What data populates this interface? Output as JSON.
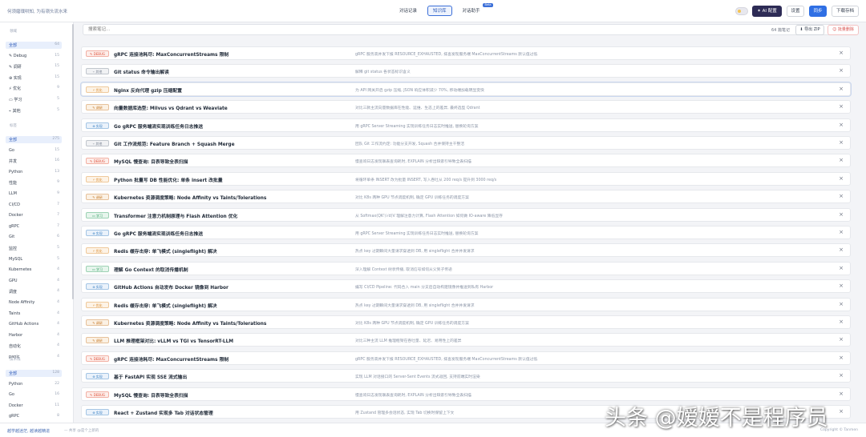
{
  "header": {
    "slogan": "何须磨璞哄知, 为有嶺头流水来",
    "tabs": [
      {
        "label": "对话记录",
        "active": false
      },
      {
        "label": "知识库",
        "active": true
      },
      {
        "label": "对话助手",
        "active": false,
        "badge": "Beta"
      }
    ],
    "ai_button": "✦ AI 配置",
    "settings_button": "设置",
    "sync_button": "同步",
    "download_button": "下载存档"
  },
  "sidebar": {
    "sections": [
      {
        "title": "领域",
        "items": [
          {
            "label": "全部",
            "count": "64",
            "selected": true
          },
          {
            "label": "✎ Debug",
            "count": "15"
          },
          {
            "label": "✎ 调研",
            "count": "15"
          },
          {
            "label": "⊕ 实现",
            "count": "15"
          },
          {
            "label": "⚡ 优化",
            "count": "9"
          },
          {
            "label": "▭ 学习",
            "count": "5"
          },
          {
            "label": "⌁ 其他",
            "count": "5"
          }
        ]
      },
      {
        "title": "标签",
        "items": [
          {
            "label": "全部",
            "count": "275",
            "selected": true
          },
          {
            "label": "Go",
            "count": "15"
          },
          {
            "label": "并发",
            "count": "16"
          },
          {
            "label": "Python",
            "count": "13"
          },
          {
            "label": "性能",
            "count": "9"
          },
          {
            "label": "LLM",
            "count": "9"
          },
          {
            "label": "CI/CD",
            "count": "7"
          },
          {
            "label": "Docker",
            "count": "7"
          },
          {
            "label": "gRPC",
            "count": "7"
          },
          {
            "label": "Git",
            "count": "6"
          },
          {
            "label": "监控",
            "count": "5"
          },
          {
            "label": "MySQL",
            "count": "5"
          },
          {
            "label": "Kubernetes",
            "count": "4"
          },
          {
            "label": "GPU",
            "count": "4"
          },
          {
            "label": "调度",
            "count": "4"
          },
          {
            "label": "Node Affinity",
            "count": "4"
          },
          {
            "label": "Taints",
            "count": "4"
          },
          {
            "label": "GitHub Actions",
            "count": "4"
          },
          {
            "label": "Harbor",
            "count": "4"
          },
          {
            "label": "自动化",
            "count": "4"
          },
          {
            "label": "panic",
            "count": "4"
          }
        ]
      },
      {
        "title": "技术栈",
        "items": [
          {
            "label": "全部",
            "count": "128",
            "selected": true
          },
          {
            "label": "Python",
            "count": "22"
          },
          {
            "label": "Go",
            "count": "16"
          },
          {
            "label": "Docker",
            "count": "11"
          },
          {
            "label": "gRPC",
            "count": "8"
          }
        ]
      }
    ]
  },
  "toolbar": {
    "search_placeholder": "搜索笔记...",
    "note_count": "64 篇笔记",
    "export_label": "⬇ 导出 ZIP",
    "bulk_delete_label": "☺ 批量删除"
  },
  "tag_styles": {
    "DEBUG": {
      "color": "#e0533d",
      "bg": "#fdeeea"
    },
    "实现": {
      "color": "#3b82c4",
      "bg": "#eaf2fb"
    },
    "优化": {
      "color": "#d9892b",
      "bg": "#fdf3e6"
    },
    "调研": {
      "color": "#c77b2a",
      "bg": "#fbf1e4"
    },
    "学习": {
      "color": "#2f9e62",
      "bg": "#e6f5ec"
    },
    "其他": {
      "color": "#7b8494",
      "bg": "#f1f2f4"
    }
  },
  "rows": [
    {
      "tag": "DEBUG",
      "tag_label": "✎ DEBUG",
      "title": "gRPC 连接池耗尽: MaxConcurrentStreams 限制",
      "desc": "gRPC 服务高并发下报 RESOURCE_EXHAUSTED, 排查发现服务端 MaxConcurrentStreams 默认值过低"
    },
    {
      "tag": "其他",
      "tag_label": "⌁ 其他",
      "title": "Git status 命令输出解读",
      "desc": "解释 git status 各状态标识含义"
    },
    {
      "tag": "优化",
      "tag_label": "⚡ 优化",
      "title": "Nginx 反向代理 gzip 压缩配置",
      "desc": "为 API 网关开启 gzip 压缩, JSON 响应体积减少 70%, 移动端加载明显变快",
      "highlight": true
    },
    {
      "tag": "调研",
      "tag_label": "✎ 调研",
      "title": "向量数据库选型: Milvus vs Qdrant vs Weaviate",
      "desc": "对比三款主流向量数据库在性能、运维、生态上的差异, 最终选型 Qdrant"
    },
    {
      "tag": "实现",
      "tag_label": "⊕ 实现",
      "title": "Go gRPC 服务端流实现训练任务日志推送",
      "desc": "用 gRPC Server Streaming 实现训练任务日志实时推送, 替换轮询方案"
    },
    {
      "tag": "其他",
      "tag_label": "⌁ 其他",
      "title": "Git 工作流规范: Feature Branch + Squash Merge",
      "desc": "团队 Git 工作流约定: 功能分支开发, Squash 合并保持主干整洁"
    },
    {
      "tag": "DEBUG",
      "tag_label": "✎ DEBUG",
      "title": "MySQL 慢查询: 目表导致全表扫描",
      "desc": "慢查询日志发现联表查询耗时, EXPLAIN 分析出缺索引导致全表扫描"
    },
    {
      "tag": "优化",
      "tag_label": "⚡ 优化",
      "title": "Python 批量写 DB 性能优化: 单条 insert 改批量",
      "desc": "将循环单条 INSERT 改为批量 INSERT, 写入吞吐从 200 req/s 提升到 3000 req/s"
    },
    {
      "tag": "调研",
      "tag_label": "✎ 调研",
      "title": "Kubernetes 资源调度策略: Node Affinity vs Taints/Tolerations",
      "desc": "对比 K8s 两种 GPU 节点调度机制, 确定 GPU 训练任务的调度方案"
    },
    {
      "tag": "学习",
      "tag_label": "▭ 学习",
      "title": "Transformer 注意力机制原理与 Flash Attention 优化",
      "desc": "从 Softmax(QKᵀ/√d)V 理解注意力计算, Flash Attention 如何做 IO-aware 降低显存"
    },
    {
      "tag": "实现",
      "tag_label": "⊕ 实现",
      "title": "Go gRPC 服务端流实现训练任务日志推送",
      "desc": "用 gRPC Server Streaming 实现训练任务日志实时推送, 替换轮询方案"
    },
    {
      "tag": "优化",
      "tag_label": "⚡ 优化",
      "title": "Redis 缓存击穿: 单飞模式 (singleflight) 解决",
      "desc": "热点 key 过期瞬间大量请求穿透到 DB, 用 singleflight 合并并发请求"
    },
    {
      "tag": "学习",
      "tag_label": "▭ 学习",
      "title": "理解 Go Context 的取消传播机制",
      "desc": "深入理解 Context 树状传播, 取消信号如何从父到子传递"
    },
    {
      "tag": "实现",
      "tag_label": "⊕ 实现",
      "title": "GitHub Actions 自动发布 Docker 镜像到 Harbor",
      "desc": "编写 CI/CD Pipeline: 代码合入 main 分支后自动构建镜像并推送到私有 Harbor"
    },
    {
      "tag": "优化",
      "tag_label": "⚡ 优化",
      "title": "Redis 缓存击穿: 单飞模式 (singleflight) 解决",
      "desc": "热点 key 过期瞬间大量请求穿透到 DB, 用 singleflight 合并并发请求"
    },
    {
      "tag": "调研",
      "tag_label": "✎ 调研",
      "title": "Kubernetes 资源调度策略: Node Affinity vs Taints/Tolerations",
      "desc": "对比 K8s 两种 GPU 节点调度机制, 确定 GPU 训练任务的调度方案"
    },
    {
      "tag": "调研",
      "tag_label": "✎ 调研",
      "title": "LLM 推理框架对比: vLLM vs TGI vs TensorRT-LLM",
      "desc": "对比三种主流 LLM 推理框架在吞吐量、延迟、易用性上的差异"
    },
    {
      "tag": "DEBUG",
      "tag_label": "✎ DEBUG",
      "title": "gRPC 连接池耗尽: MaxConcurrentStreams 限制",
      "desc": "gRPC 服务高并发下报 RESOURCE_EXHAUSTED, 排查发现服务端 MaxConcurrentStreams 默认值过低"
    },
    {
      "tag": "实现",
      "tag_label": "⊕ 实现",
      "title": "基于 FastAPI 实现 SSE 流式输出",
      "desc": "实现 LLM 对话接口的 Server-Sent Events 流式返回, 支持前端实时渲染"
    },
    {
      "tag": "DEBUG",
      "tag_label": "✎ DEBUG",
      "title": "MySQL 慢查询: 目表导致全表扫描",
      "desc": "慢查询日志发现联表查询耗时, EXPLAIN 分析出缺索引导致全表扫描"
    },
    {
      "tag": "实现",
      "tag_label": "⊕ 实现",
      "title": "React + Zustand 实现多 Tab 对话状态管理",
      "desc": "用 Zustand 管理多会话状态, 实现 Tab 切换时保留上下文"
    }
  ],
  "footer": {
    "left": "越学越迷茫, 越读越精进",
    "sub": "— 共享 @是个上新的",
    "right": "Copyright © Tanmen"
  },
  "watermark": "头条 @嫒嫒不是程序员"
}
